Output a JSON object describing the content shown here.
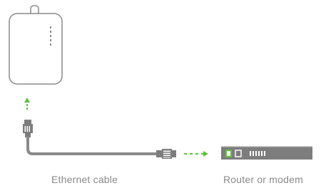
{
  "labels": {
    "cable": "Ethernet cable",
    "router": "Router or modem"
  },
  "colors": {
    "outline": "#8a8a8a",
    "arrow": "#5cc23a",
    "router_body": "#7d7d7d",
    "router_light": "#5cc23a",
    "caption": "#8a8a8a"
  },
  "icons": {
    "device": "hardware-unit-icon",
    "cable_plug_top": "ethernet-plug-icon",
    "cable_plug_side": "ethernet-plug-icon",
    "router": "router-icon"
  }
}
